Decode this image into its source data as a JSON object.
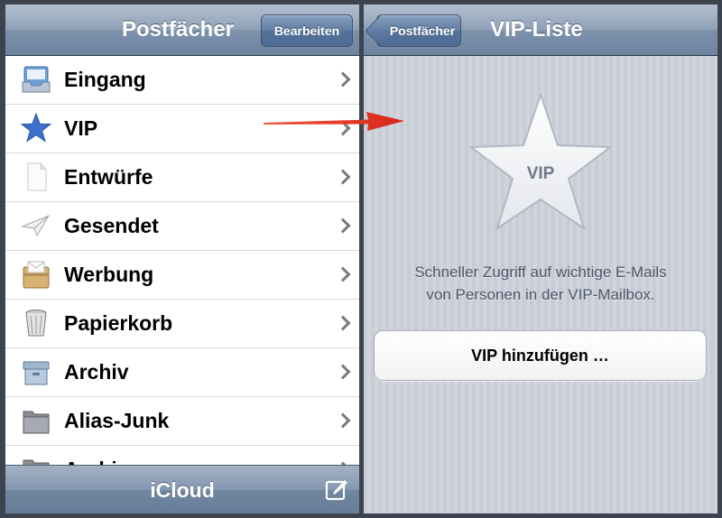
{
  "left_screen": {
    "title": "Postfächer",
    "edit_label": "Bearbeiten",
    "mailboxes": [
      {
        "label": "Eingang",
        "icon": "inbox-icon"
      },
      {
        "label": "VIP",
        "icon": "star-icon"
      },
      {
        "label": "Entwürfe",
        "icon": "draft-document-icon"
      },
      {
        "label": "Gesendet",
        "icon": "paper-plane-icon"
      },
      {
        "label": "Werbung",
        "icon": "envelope-box-icon"
      },
      {
        "label": "Papierkorb",
        "icon": "trash-bin-icon"
      },
      {
        "label": "Archiv",
        "icon": "archive-box-icon"
      },
      {
        "label": "Alias-Junk",
        "icon": "folder-icon"
      },
      {
        "label": "Archiv",
        "icon": "folder-icon"
      }
    ],
    "toolbar_account": "iCloud",
    "compose_icon": "compose-icon"
  },
  "right_screen": {
    "back_label": "Postfächer",
    "title": "VIP-Liste",
    "star_label": "VIP",
    "description_line1": "Schneller Zugriff auf wichtige E-Mails",
    "description_line2": "von Personen in der VIP-Mailbox.",
    "add_button_label": "VIP hinzufügen …"
  },
  "colors": {
    "navbar": "#7d92ab",
    "arrow_annotation": "#e8321e",
    "star_blue": "#3f6fc8"
  }
}
